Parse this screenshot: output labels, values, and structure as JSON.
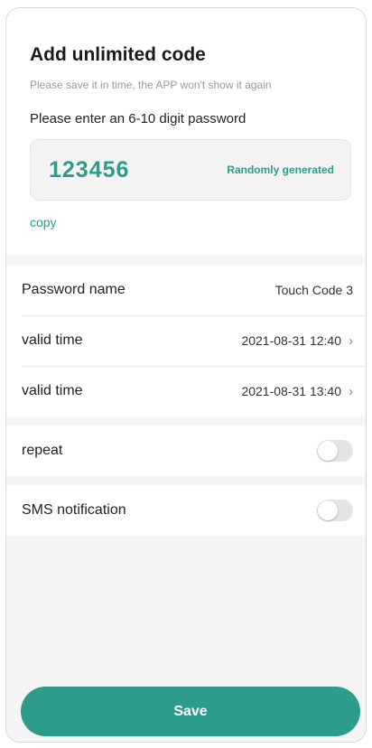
{
  "header": {
    "title": "Add unlimited code",
    "hint": "Please save it in time, the APP won't show it again",
    "prompt": "Please enter an 6-10 digit password"
  },
  "password": {
    "value": "123456",
    "generate_label": "Randomly generated",
    "copy_label": "copy"
  },
  "details": [
    {
      "label": "Password name",
      "value": "Touch Code 3"
    },
    {
      "label": "valid time",
      "value": "2021-08-31 12:40",
      "icon": "chevron-right-icon"
    },
    {
      "label": "valid time",
      "value": "2021-08-31 13:40",
      "icon": "chevron-right-icon"
    }
  ],
  "repeat": {
    "label": "repeat",
    "enabled": false
  },
  "sms": {
    "label": "SMS notification",
    "enabled": false
  },
  "save_label": "Save",
  "colors": {
    "accent": "#2e9c8a",
    "toggle_off": "#e4e4e4"
  }
}
